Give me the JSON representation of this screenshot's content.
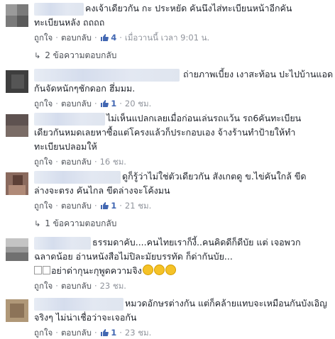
{
  "labels": {
    "like": "ถูกใจ",
    "reply": "ตอบกลับ",
    "dot": "·"
  },
  "colors": {
    "link": "#4267b2",
    "meta": "#90949c",
    "text": "#1d2129"
  },
  "comments": [
    {
      "text_lines": [
        "คงเจ้าเดียวกัน กะ ประหยัด คันนึงไส่ทะเบียนหน้าอีกคัน",
        "ทะเบียนหลัง ถถถถ"
      ],
      "likes": "4",
      "time": "เมื่อวานนี้ เวลา 9:01 น.",
      "replies": "2 ข้อความตอบกลับ"
    },
    {
      "text_lines": [
        "ถ่ายภาพเบี้ยง เงาสะท้อน ปะไปบ้านแอด",
        "กันจัดหนักๆชักดอก ฮึ่มมม."
      ],
      "likes": "1",
      "time": "20 ชม."
    },
    {
      "text_lines": [
        "ไม่เห็นแปลกเลยเมื่อก่อนเล่นรถแว้น รถ6คันทะเบียน",
        "เดียวกันหมดเลยหาซื้อแต่โครงแล้วก็ประกอบเอง จ้างร้านทำป้ายให้ทำ",
        "ทะเบียนปลอมให้"
      ],
      "time": "16 ชม."
    },
    {
      "text_lines": [
        "ดูก็รู้ว่าไม่ใช่ตัวเดียวกัน สังเกตดู ข.ไข่คันใกล้ ขีด",
        "ล่างจะตรง คันไกล ขีดล่างจะโค้งมน"
      ],
      "likes": "1",
      "time": "21 ชม.",
      "replies": "1 ข้อความตอบกลับ"
    },
    {
      "text_lines": [
        "ธรรมดาคับ....คนไทยเราก็งี้..คนคิดดีก็ดีบัย แต่ เจอพวก",
        "ฉลาดน้อย อ่านหนังสือไม่ปิละมัยบรรทัด ก็ด่ากันบัย...",
        "อย่าด่ากุนะกุพูดความจิง"
      ],
      "time": "23 ชม."
    },
    {
      "text_lines": [
        "หมวดอักษรต่างกัน แต่ก็คล้ายแทบจะเหมือนกันบังเอิญ",
        "จริงๆ ไม่น่าเชื่อว่าจะเจอกัน"
      ],
      "likes": "1",
      "time": "23 ชม."
    }
  ]
}
